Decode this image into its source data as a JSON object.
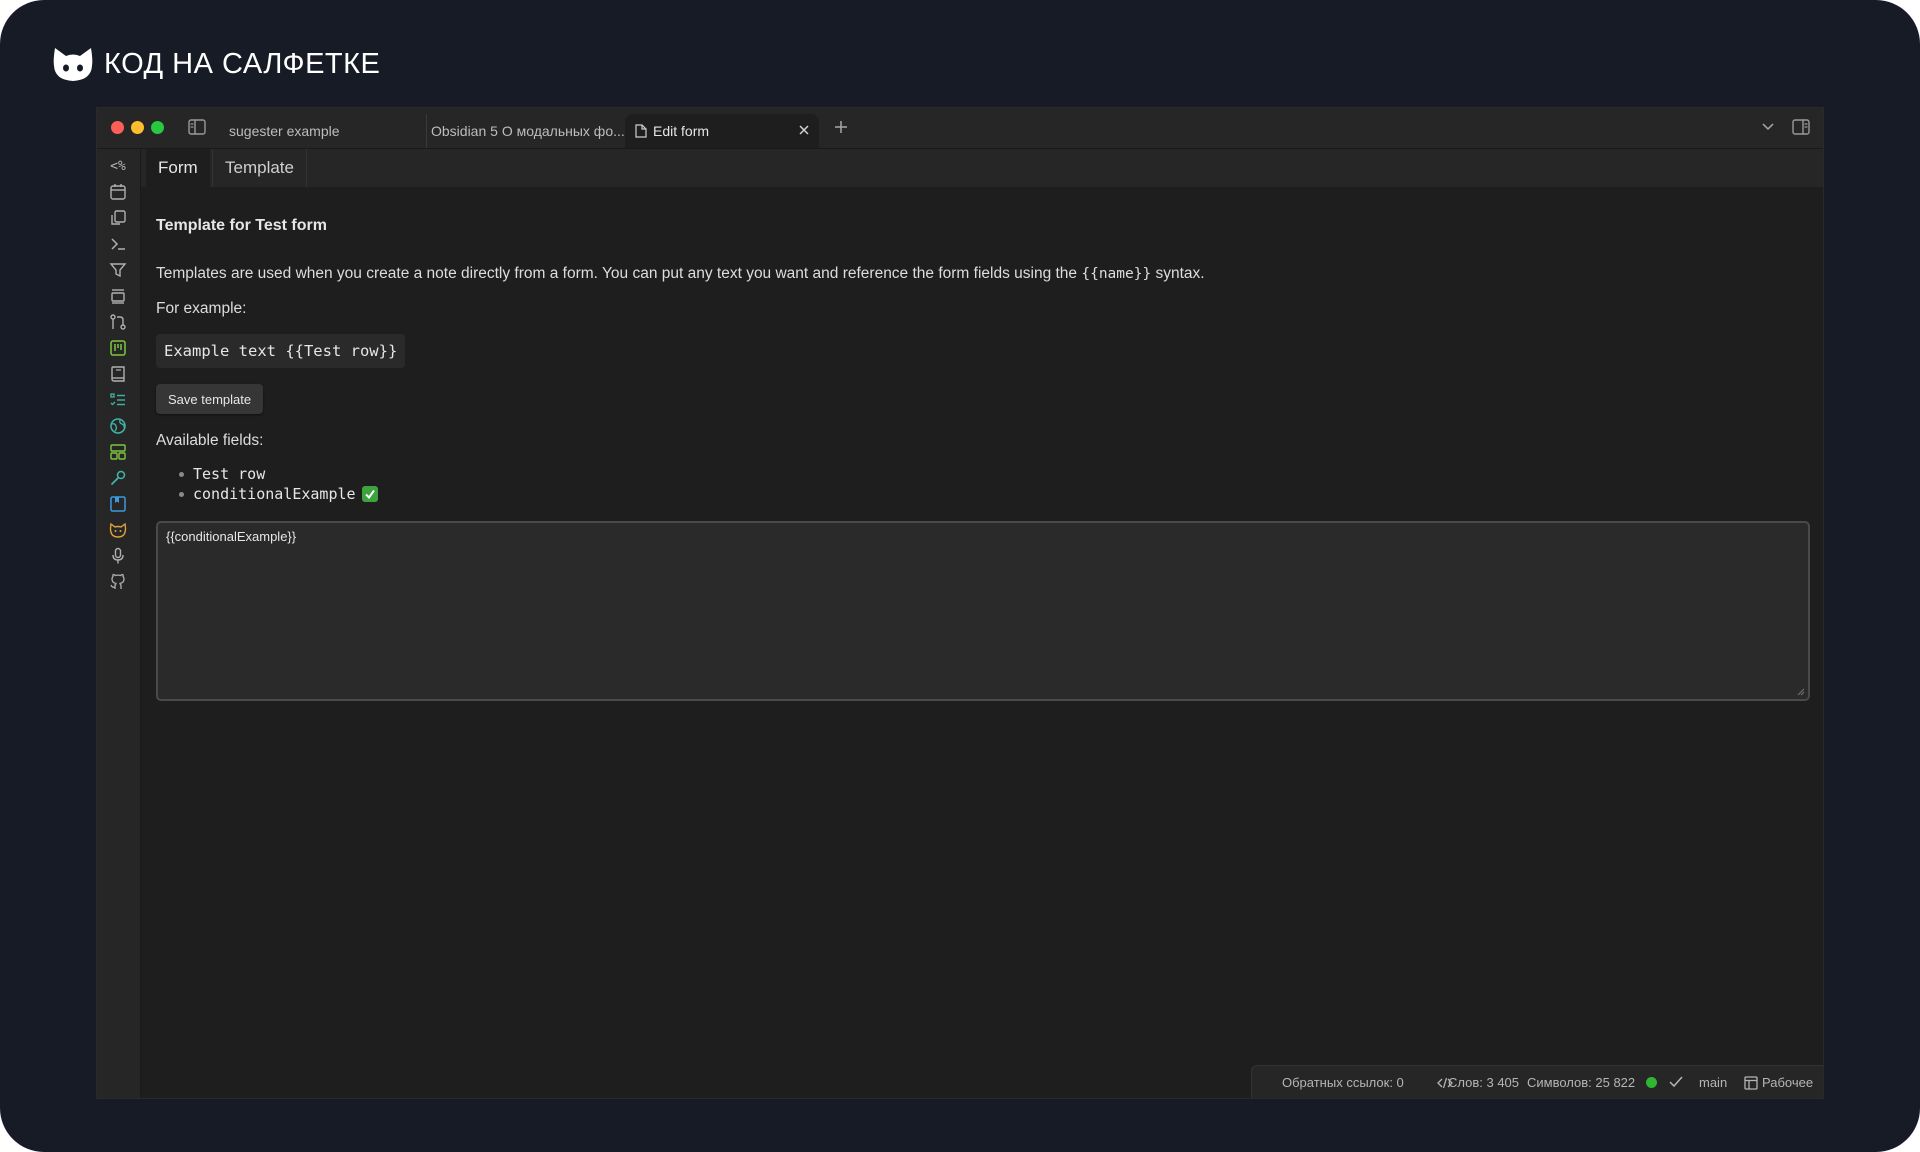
{
  "brand": {
    "name": "КОД НА САЛФЕТКЕ",
    "logo": "cat-head-icon"
  },
  "window": {
    "tabs": [
      {
        "label": "sugester example"
      },
      {
        "label": "Obsidian 5 О модальных фо..."
      },
      {
        "label": "Edit form",
        "active": true
      }
    ]
  },
  "ribbon": {
    "first_label": "<%",
    "icons": [
      "calendar-icon",
      "copy-icon",
      "terminal-icon",
      "filter-icon",
      "layers-icon",
      "git-compare-icon",
      "kanban-icon",
      "book-icon",
      "list-checks-icon",
      "globe-icon",
      "layout-icon",
      "wrench-icon",
      "bookmark-icon",
      "cat-icon",
      "microphone-icon",
      "github-icon"
    ],
    "accent_colors": {
      "green": "#7ec63f",
      "teal": "#3fb6a8",
      "blue": "#3a9be0",
      "orange": "#e0a23a"
    }
  },
  "view_tabs": {
    "form": "Form",
    "template": "Template"
  },
  "main": {
    "heading": "Template for Test form",
    "description_before": "Templates are used when you create a note directly from a form. You can put any text you want and reference the form fields using the ",
    "description_code": "{{name}}",
    "description_after": " syntax.",
    "for_example": "For example:",
    "example_code": "Example text {{Test row}}",
    "save_button": "Save template",
    "available_fields_label": "Available fields:",
    "fields": [
      "Test row",
      "conditionalExample"
    ],
    "editor_value": "{{conditionalExample}}"
  },
  "status_bar": {
    "backlinks": "Обратных ссылок: 0",
    "words": "Слов: 3 405",
    "chars": "Символов: 25 822",
    "branch": "main",
    "workspace": "Рабочее"
  }
}
